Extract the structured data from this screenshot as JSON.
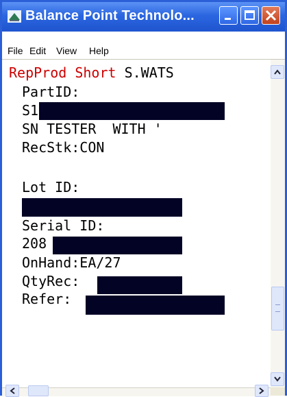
{
  "window": {
    "title": "Balance Point Technolo..."
  },
  "menu": [
    "File",
    "Edit",
    "View",
    "Help"
  ],
  "screen": {
    "header_red": "RepProd Short",
    "header_plain": " S.WATS",
    "part_label": "PartID:",
    "part_value": "S1",
    "desc": "SN TESTER  WITH '",
    "recstk": "RecStk:CON",
    "lot_label": "Lot ID:",
    "serial_label": "Serial ID:",
    "serial_value": "208",
    "onhand": "OnHand:EA/27",
    "qtyrec": "QtyRec:",
    "refer": "Refer:"
  },
  "colors": {
    "title_bar": "#2b66e0",
    "header_text": "#cc0000",
    "redaction": "#030326"
  }
}
